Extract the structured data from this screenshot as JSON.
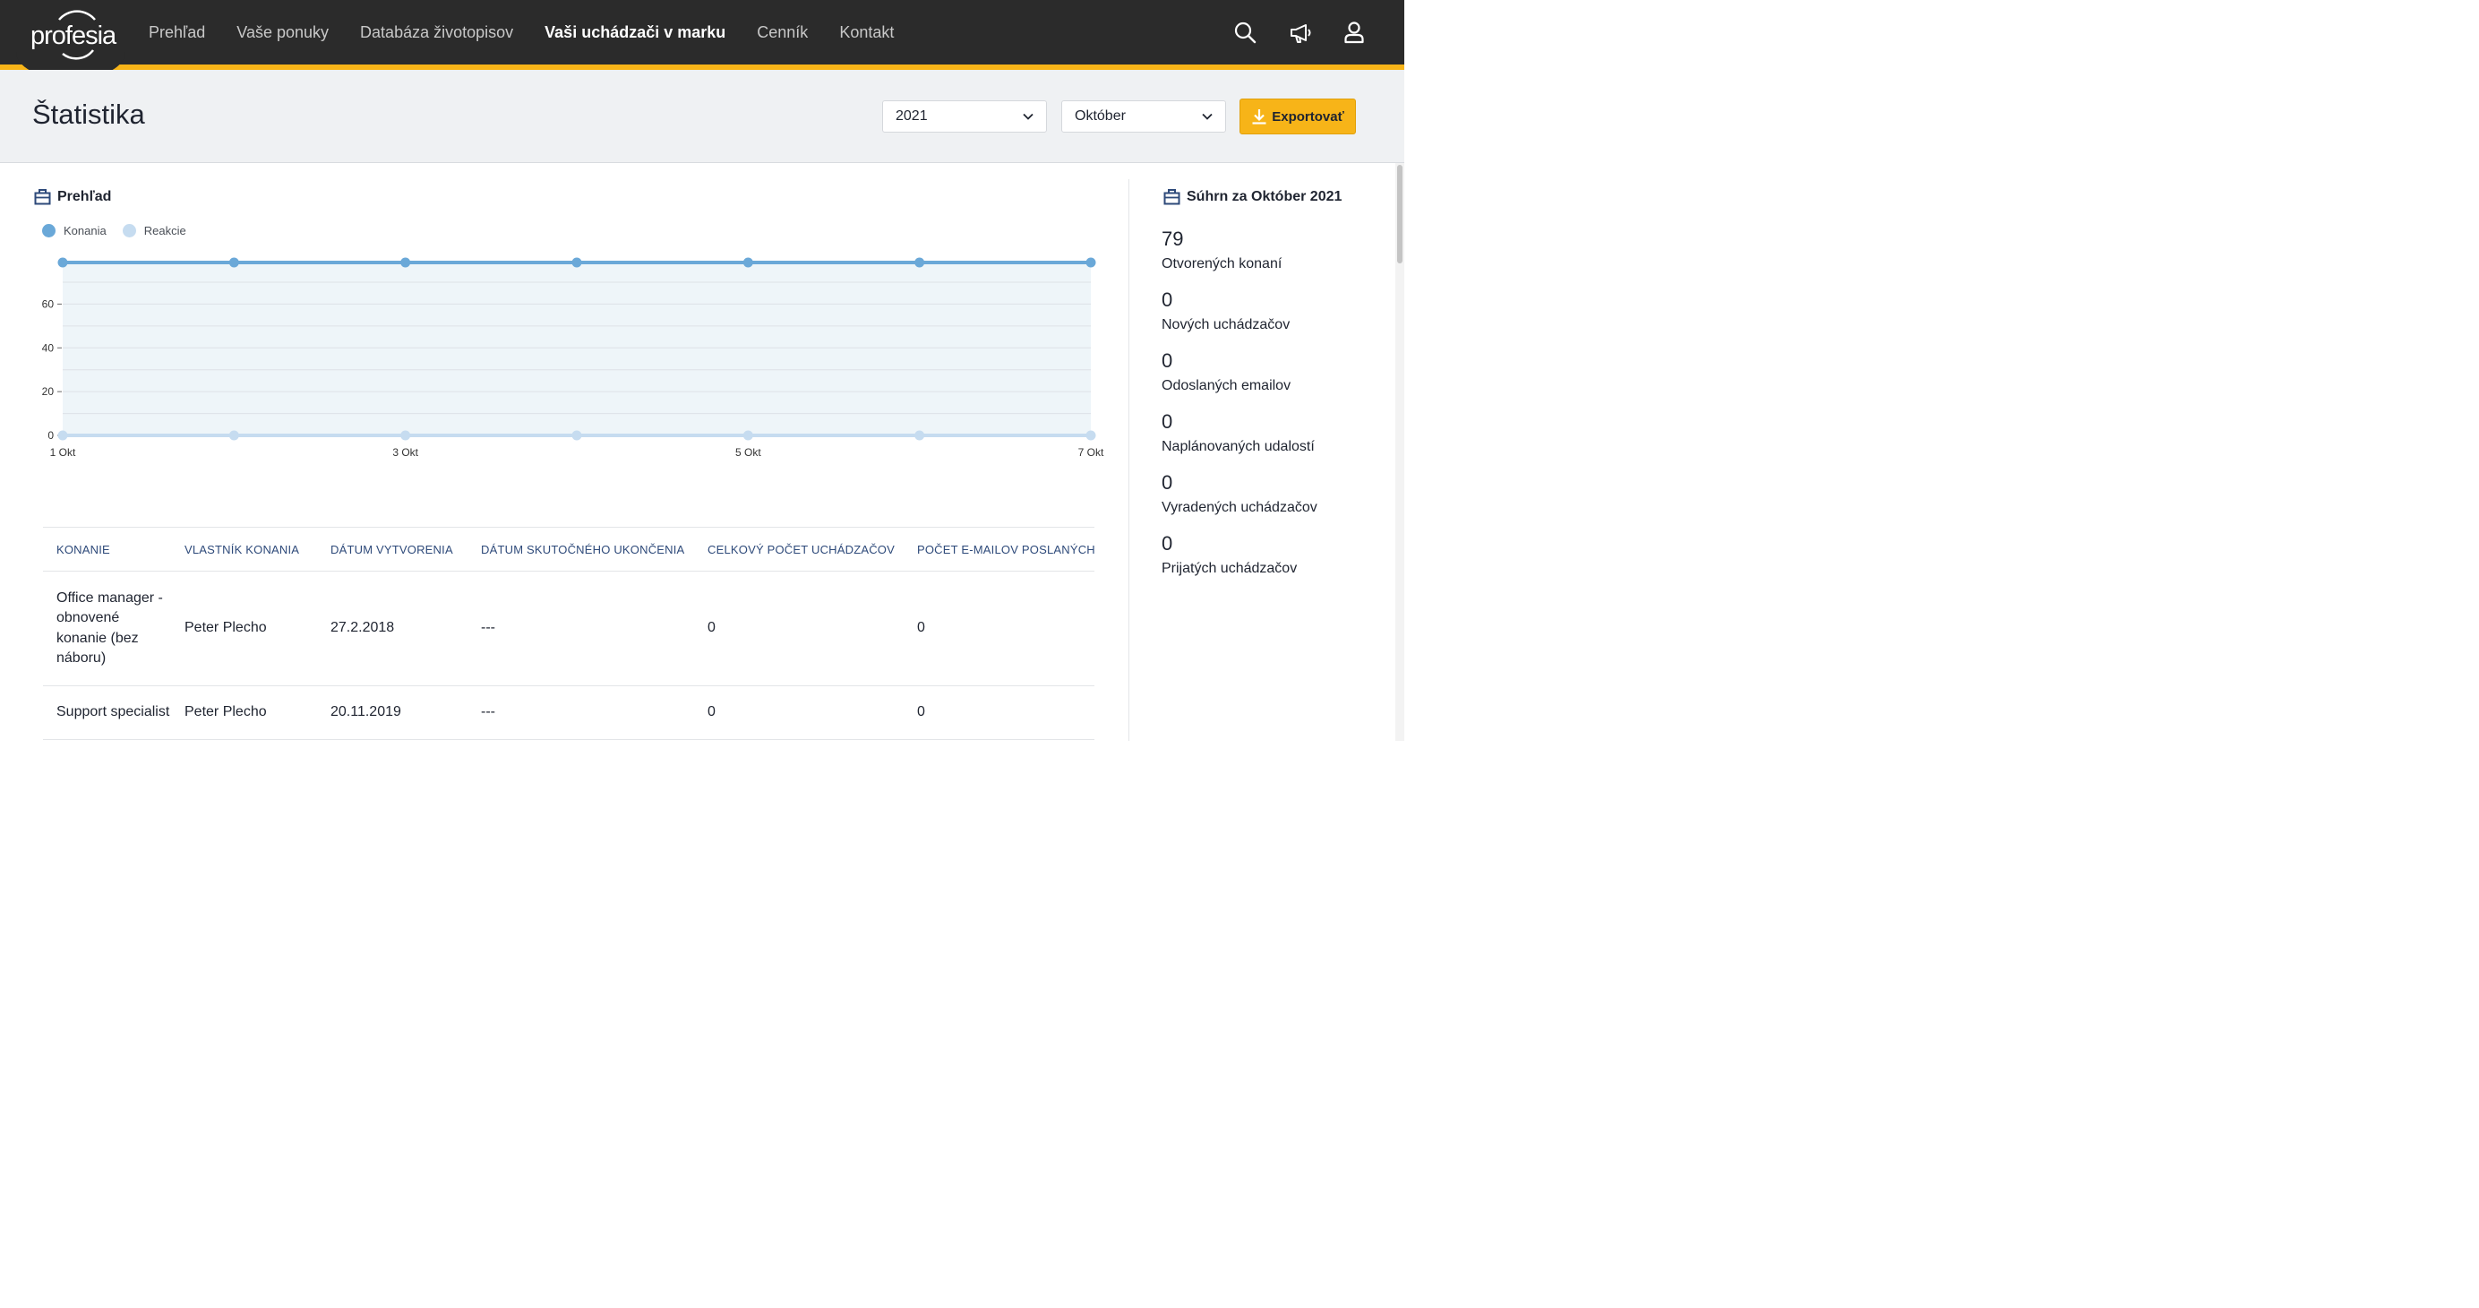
{
  "brand": {
    "logo_text": "profesia",
    "accent": "#f7b418",
    "topbar_bg": "#2b2b2b"
  },
  "nav": {
    "items": [
      {
        "label": "Prehľad",
        "active": false
      },
      {
        "label": "Vaše ponuky",
        "active": false
      },
      {
        "label": "Databáza životopisov",
        "active": false
      },
      {
        "label": "Vaši uchádzači v marku",
        "active": true
      },
      {
        "label": "Cenník",
        "active": false
      },
      {
        "label": "Kontakt",
        "active": false
      }
    ],
    "icons": [
      "search-icon",
      "megaphone-icon",
      "user-icon"
    ]
  },
  "header": {
    "title": "Štatistika",
    "year_select": "2021",
    "month_select": "Október",
    "export_label": "Exportovať"
  },
  "overview": {
    "title": "Prehľad",
    "legend": [
      {
        "label": "Konania",
        "color": "#6aa8d8"
      },
      {
        "label": "Reakcie",
        "color": "#c6dcf0"
      }
    ]
  },
  "chart_data": {
    "type": "line",
    "x": [
      "1 Okt",
      "2 Okt",
      "3 Okt",
      "4 Okt",
      "5 Okt",
      "6 Okt",
      "7 Okt"
    ],
    "x_tick_labels": [
      "1 Okt",
      "3 Okt",
      "5 Okt",
      "7 Okt"
    ],
    "series": [
      {
        "name": "Konania",
        "values": [
          79,
          79,
          79,
          79,
          79,
          79,
          79
        ],
        "color": "#6aa8d8"
      },
      {
        "name": "Reakcie",
        "values": [
          0,
          0,
          0,
          0,
          0,
          0,
          0
        ],
        "color": "#c6dcf0"
      }
    ],
    "y_ticks": [
      0,
      20,
      40,
      60
    ],
    "ylim": [
      0,
      79
    ],
    "grid": true,
    "legend_position": "top-left"
  },
  "table": {
    "headers": [
      "Konanie",
      "Vlastník konania",
      "Dátum vytvorenia",
      "Dátum skutočného ukončenia",
      "Celkový počet uchádzačov",
      "Počet e-mailov poslaných u"
    ],
    "rows": [
      {
        "konanie": "Office manager - obnovené konanie (bez náboru)",
        "owner": "Peter Plecho",
        "created": "27.2.2018",
        "ended": "---",
        "total": "0",
        "emails": "0"
      },
      {
        "konanie": "Support specialist",
        "owner": "Peter Plecho",
        "created": "20.11.2019",
        "ended": "---",
        "total": "0",
        "emails": "0"
      }
    ]
  },
  "summary": {
    "title": "Súhrn za Október 2021",
    "stats": [
      {
        "value": "79",
        "label": "Otvorených konaní"
      },
      {
        "value": "0",
        "label": "Nových uchádzačov"
      },
      {
        "value": "0",
        "label": "Odoslaných emailov"
      },
      {
        "value": "0",
        "label": "Naplánovaných udalostí"
      },
      {
        "value": "0",
        "label": "Vyradených uchádzačov"
      },
      {
        "value": "0",
        "label": "Prijatých uchádzačov"
      }
    ]
  }
}
